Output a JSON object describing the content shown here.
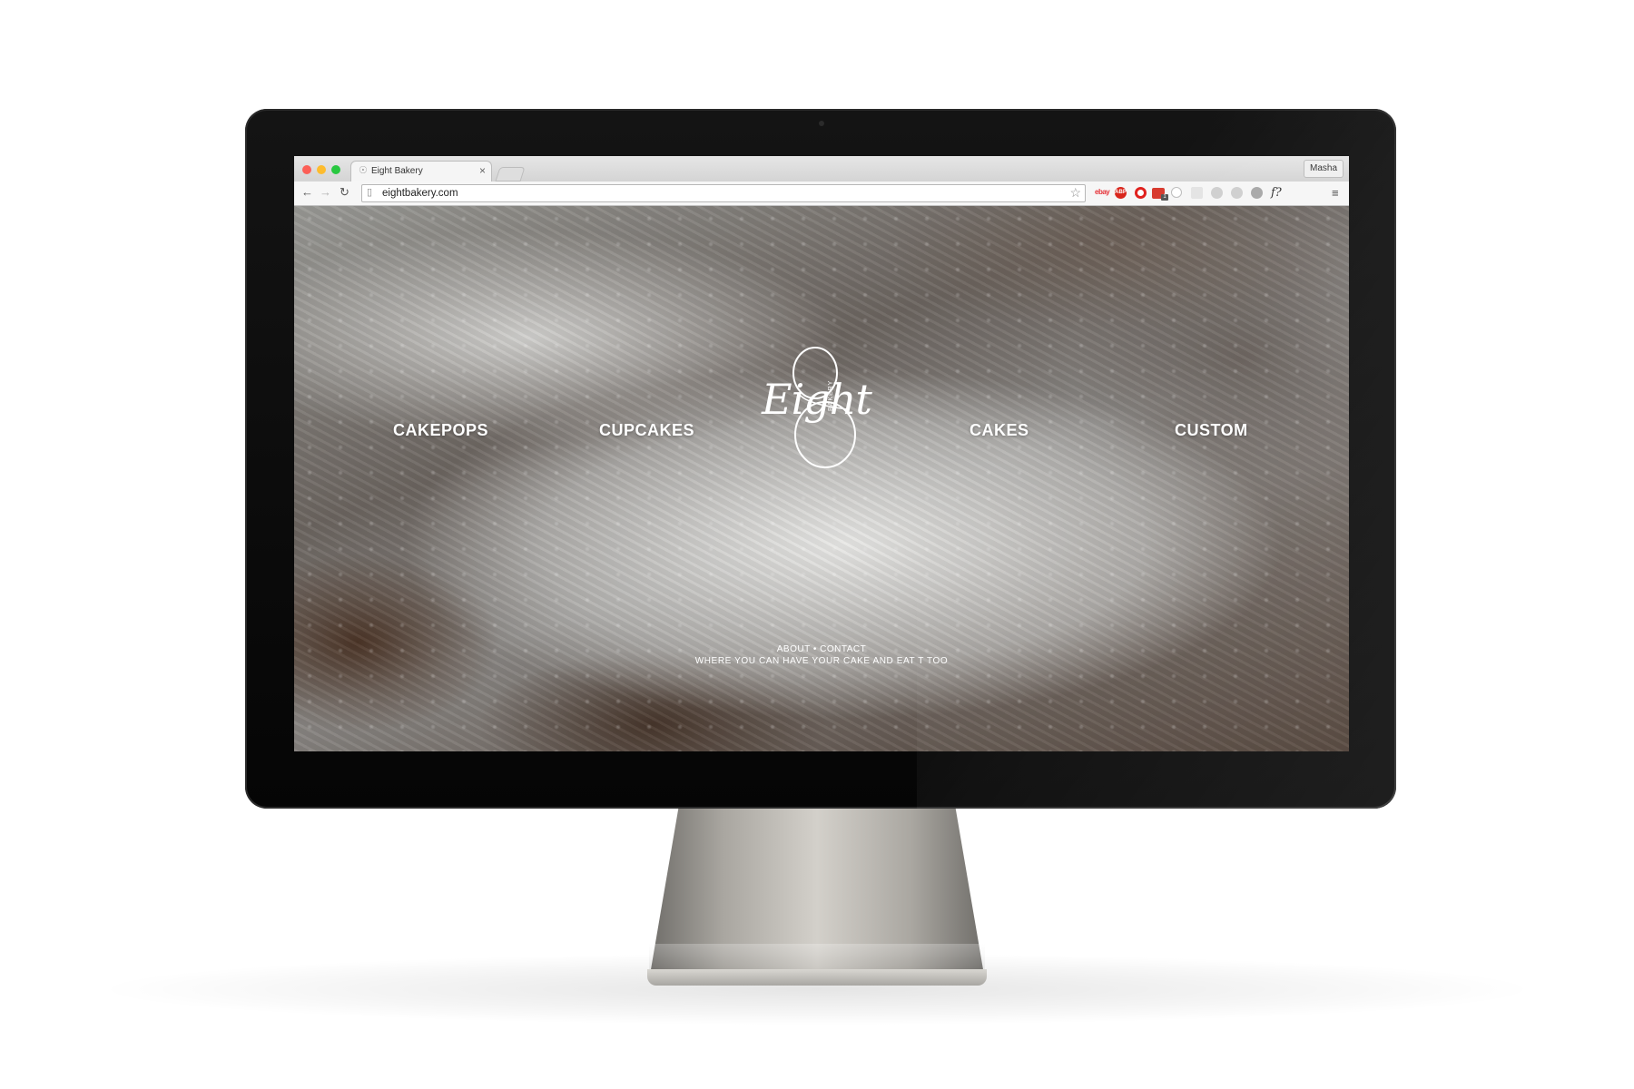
{
  "browser": {
    "tab_title": "Eight Bakery",
    "tab_close": "×",
    "profile_name": "Masha",
    "url": "eightbakery.com",
    "extensions": {
      "ebay_label": "ebay",
      "abp_label": "ABP",
      "mail_badge": "1",
      "font_label": "f?"
    }
  },
  "site": {
    "nav": {
      "cakepops": "CAKEPOPS",
      "cupcakes": "CUPCAKES",
      "cakes": "CAKES",
      "custom": "CUSTOM"
    },
    "logo": {
      "script": "Eight",
      "sub": "BAKERY"
    },
    "footer": {
      "about": "ABOUT",
      "separator": "•",
      "contact": "CONTACT",
      "tagline": "WHERE YOU CAN HAVE YOUR CAKE AND EAT T TOO"
    }
  },
  "colors": {
    "traffic_red": "#fc5f57",
    "traffic_yellow": "#fdbc2e",
    "traffic_green": "#28c840",
    "abp_red": "#d9261c"
  }
}
